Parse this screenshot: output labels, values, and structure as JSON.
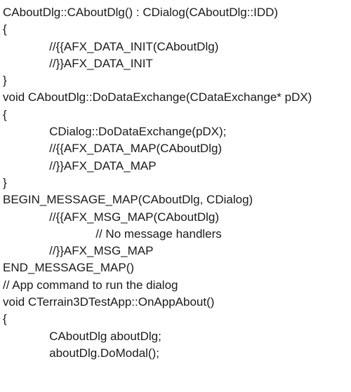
{
  "code": {
    "lines": [
      "CAboutDlg::CAboutDlg() : CDialog(CAboutDlg::IDD)",
      "{",
      "              //{{AFX_DATA_INIT(CAboutDlg)",
      "              //}}AFX_DATA_INIT",
      "}",
      "",
      "void CAboutDlg::DoDataExchange(CDataExchange* pDX)",
      "{",
      "              CDialog::DoDataExchange(pDX);",
      "              //{{AFX_DATA_MAP(CAboutDlg)",
      "              //}}AFX_DATA_MAP",
      "}",
      "",
      "BEGIN_MESSAGE_MAP(CAboutDlg, CDialog)",
      "              //{{AFX_MSG_MAP(CAboutDlg)",
      "                            // No message handlers",
      "              //}}AFX_MSG_MAP",
      "END_MESSAGE_MAP()",
      "",
      "// App command to run the dialog",
      "void CTerrain3DTestApp::OnAppAbout()",
      "{",
      "              CAboutDlg aboutDlg;",
      "              aboutDlg.DoModal();"
    ]
  }
}
